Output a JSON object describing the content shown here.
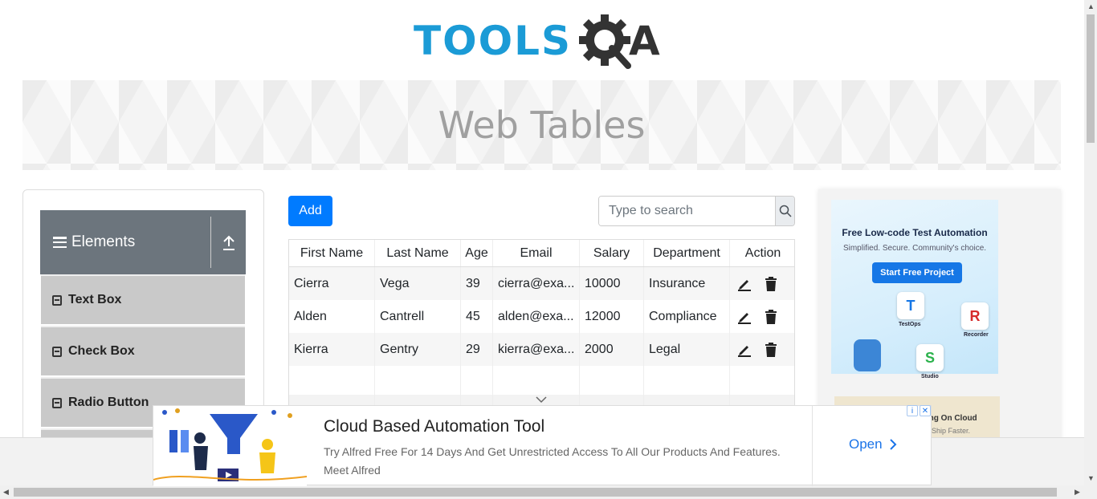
{
  "logo": {
    "text_blue": "TOOLS",
    "text_dark": "A"
  },
  "banner": {
    "title": "Web Tables"
  },
  "sidebar": {
    "group_title": "Elements",
    "items": [
      {
        "label": "Text Box"
      },
      {
        "label": "Check Box"
      },
      {
        "label": "Radio Button"
      }
    ]
  },
  "toolbar": {
    "add_label": "Add",
    "search_placeholder": "Type to search"
  },
  "table": {
    "headers": [
      "First Name",
      "Last Name",
      "Age",
      "Email",
      "Salary",
      "Department",
      "Action"
    ],
    "rows": [
      [
        "Cierra",
        "Vega",
        "39",
        "cierra@exa...",
        "10000",
        "Insurance"
      ],
      [
        "Alden",
        "Cantrell",
        "45",
        "alden@exa...",
        "12000",
        "Compliance"
      ],
      [
        "Kierra",
        "Gentry",
        "29",
        "kierra@exa...",
        "2000",
        "Legal"
      ]
    ]
  },
  "right_ad": {
    "headline": "Free Low-code Test Automation",
    "subline": "Simplified. Secure. Community's choice.",
    "cta": "Start Free Project",
    "tiles": [
      "TestOps",
      "Recorder",
      "Studio"
    ],
    "second_headline": "sting On Cloud",
    "second_sub": ". Ship Faster."
  },
  "bottom_ad": {
    "title": "Cloud Based Automation Tool",
    "description": "Try Alfred Free For 14 Days And Get Unrestricted Access To All Our Products And Features. Meet Alfred",
    "cta": "Open"
  },
  "colors": {
    "brand_blue": "#1b9bd6",
    "primary": "#007bff",
    "sidebar_header": "#6c757d"
  }
}
